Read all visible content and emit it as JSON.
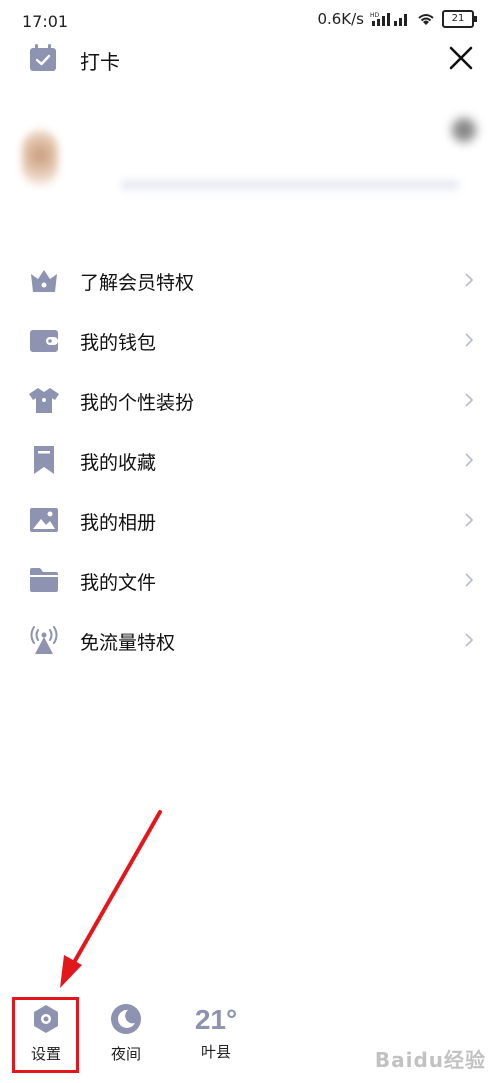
{
  "status_bar": {
    "time": "17:01",
    "network_speed": "0.6K/s",
    "network_badge": "HD",
    "battery": "21"
  },
  "header": {
    "checkin_label": "打卡",
    "close_icon": "close-icon"
  },
  "menu": {
    "items": [
      {
        "label": "了解会员特权",
        "icon": "crown-icon"
      },
      {
        "label": "我的钱包",
        "icon": "wallet-icon"
      },
      {
        "label": "我的个性装扮",
        "icon": "shirt-icon"
      },
      {
        "label": "我的收藏",
        "icon": "bookmark-icon"
      },
      {
        "label": "我的相册",
        "icon": "photo-icon"
      },
      {
        "label": "我的文件",
        "icon": "folder-icon"
      },
      {
        "label": "免流量特权",
        "icon": "signal-tower-icon"
      }
    ]
  },
  "bottom_bar": {
    "settings_label": "设置",
    "night_label": "夜间",
    "temperature": "21°",
    "location": "叶县"
  },
  "watermark": "Baidu经验",
  "colors": {
    "icon": "#8d93b0",
    "annotation": "#e3171b",
    "arrow": "#c8c8c8"
  }
}
